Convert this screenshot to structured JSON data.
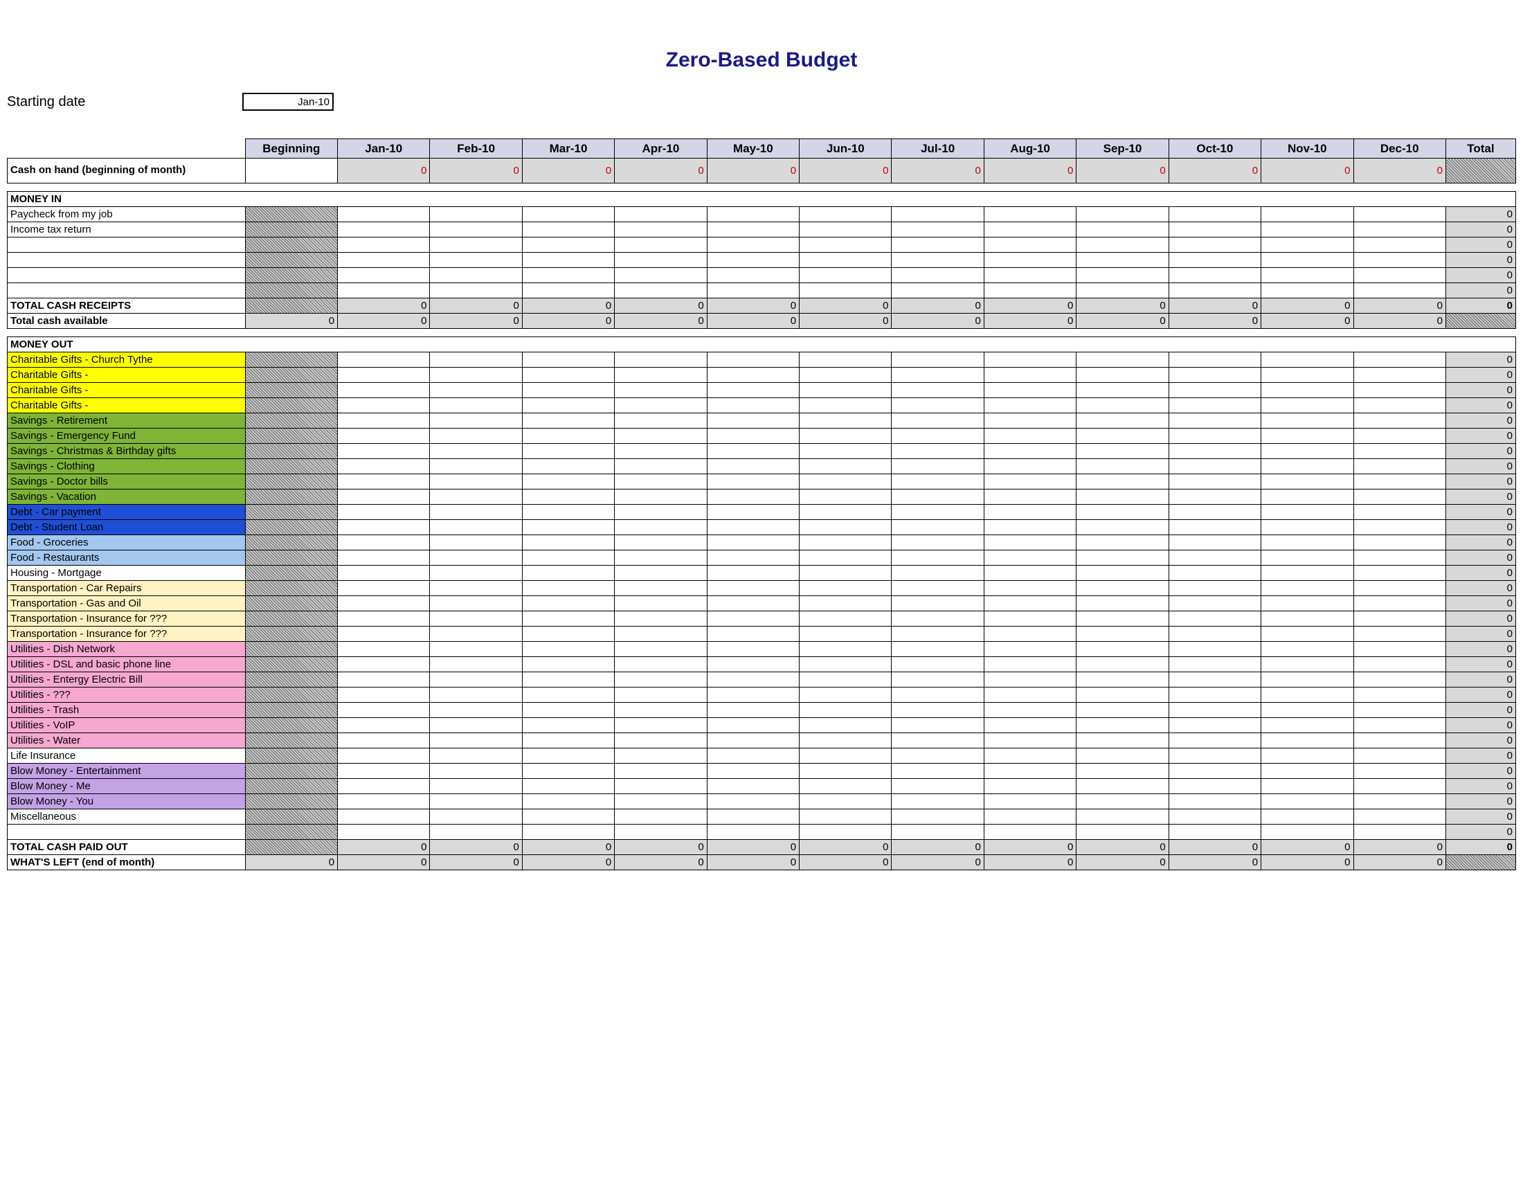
{
  "title": "Zero-Based Budget",
  "starting_label": "Starting date",
  "starting_value": "Jan-10",
  "headers": {
    "beginning": "Beginning",
    "months": [
      "Jan-10",
      "Feb-10",
      "Mar-10",
      "Apr-10",
      "May-10",
      "Jun-10",
      "Jul-10",
      "Aug-10",
      "Sep-10",
      "Oct-10",
      "Nov-10",
      "Dec-10"
    ],
    "total": "Total"
  },
  "cash_on_hand_label": "Cash on hand (beginning of month)",
  "money_in_label": "MONEY IN",
  "money_in_rows": [
    "Paycheck from my job",
    "Income tax return",
    "",
    "",
    "",
    ""
  ],
  "total_receipts_label": "TOTAL CASH RECEIPTS",
  "total_available_label": "Total cash available",
  "money_out_label": "MONEY OUT",
  "money_out_rows": [
    {
      "label": "Charitable Gifts - Church Tythe",
      "cls": "bg-yellow"
    },
    {
      "label": "Charitable Gifts -",
      "cls": "bg-yellow"
    },
    {
      "label": "Charitable Gifts -",
      "cls": "bg-yellow"
    },
    {
      "label": "Charitable Gifts -",
      "cls": "bg-yellow"
    },
    {
      "label": "Savings - Retirement",
      "cls": "bg-green"
    },
    {
      "label": "Savings - Emergency Fund",
      "cls": "bg-green"
    },
    {
      "label": "Savings - Christmas & Birthday gifts",
      "cls": "bg-green"
    },
    {
      "label": "Savings - Clothing",
      "cls": "bg-green"
    },
    {
      "label": "Savings - Doctor bills",
      "cls": "bg-green"
    },
    {
      "label": "Savings - Vacation",
      "cls": "bg-green"
    },
    {
      "label": "Debt - Car payment",
      "cls": "bg-blue"
    },
    {
      "label": "Debt - Student Loan",
      "cls": "bg-blue"
    },
    {
      "label": "Food - Groceries",
      "cls": "bg-lightblue"
    },
    {
      "label": "Food - Restaurants",
      "cls": "bg-lightblue"
    },
    {
      "label": "Housing - Mortgage",
      "cls": ""
    },
    {
      "label": "Transportation - Car Repairs",
      "cls": "bg-cream"
    },
    {
      "label": "Transportation - Gas and Oil",
      "cls": "bg-cream"
    },
    {
      "label": "Transportation - Insurance for ???",
      "cls": "bg-cream"
    },
    {
      "label": "Transportation - Insurance for ???",
      "cls": "bg-cream"
    },
    {
      "label": "Utilities - Dish Network",
      "cls": "bg-pink"
    },
    {
      "label": "Utilities - DSL and basic phone line",
      "cls": "bg-pink"
    },
    {
      "label": "Utilities - Entergy Electric Bill",
      "cls": "bg-pink"
    },
    {
      "label": "Utilities - ???",
      "cls": "bg-pink"
    },
    {
      "label": "Utilities - Trash",
      "cls": "bg-pink"
    },
    {
      "label": "Utilities - VoIP",
      "cls": "bg-pink"
    },
    {
      "label": "Utilities - Water",
      "cls": "bg-pink"
    },
    {
      "label": "Life Insurance",
      "cls": ""
    },
    {
      "label": "Blow Money - Entertainment",
      "cls": "bg-purple"
    },
    {
      "label": "Blow Money - Me",
      "cls": "bg-purple"
    },
    {
      "label": "Blow Money - You",
      "cls": "bg-purple"
    },
    {
      "label": "Miscellaneous",
      "cls": ""
    },
    {
      "label": "",
      "cls": ""
    }
  ],
  "total_paid_label": "TOTAL CASH PAID OUT",
  "whats_left_label": "WHAT'S LEFT (end of month)",
  "zero": "0"
}
